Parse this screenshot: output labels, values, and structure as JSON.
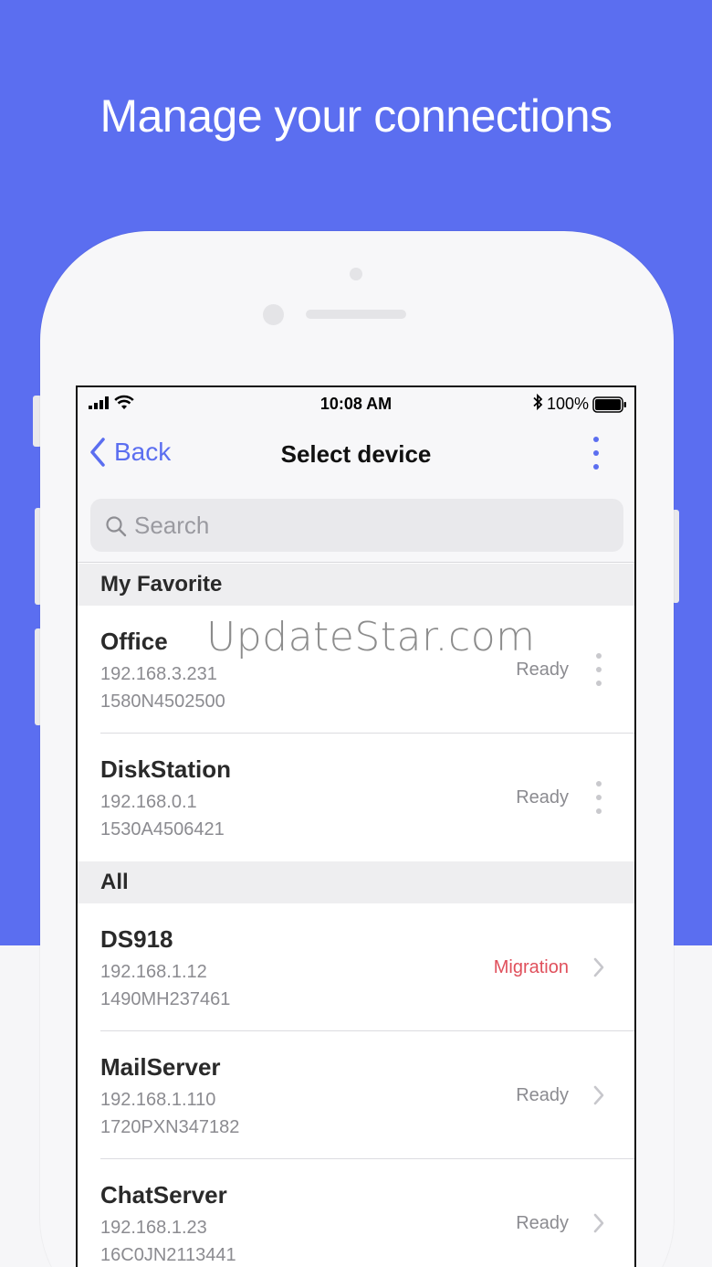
{
  "headline": "Manage your connections",
  "status_bar": {
    "time": "10:08 AM",
    "battery": "100%"
  },
  "nav": {
    "back_label": "Back",
    "title": "Select device"
  },
  "search": {
    "placeholder": "Search",
    "value": ""
  },
  "sections": {
    "favorite": {
      "title": "My Favorite",
      "devices": [
        {
          "name": "Office",
          "ip": "192.168.3.231",
          "serial": "1580N4502500",
          "status": "Ready"
        },
        {
          "name": "DiskStation",
          "ip": "192.168.0.1",
          "serial": "1530A4506421",
          "status": "Ready"
        }
      ]
    },
    "all": {
      "title": "All",
      "devices": [
        {
          "name": "DS918",
          "ip": "192.168.1.12",
          "serial": "1490MH237461",
          "status": "Migration"
        },
        {
          "name": "MailServer",
          "ip": "192.168.1.110",
          "serial": "1720PXN347182",
          "status": "Ready"
        },
        {
          "name": "ChatServer",
          "ip": "192.168.1.23",
          "serial": "16C0JN2113441",
          "status": "Ready"
        }
      ]
    }
  },
  "watermark": "UpdateStar.com",
  "colors": {
    "brand": "#5b6ef0",
    "migration": "#e0505c",
    "muted": "#8b8b90"
  }
}
